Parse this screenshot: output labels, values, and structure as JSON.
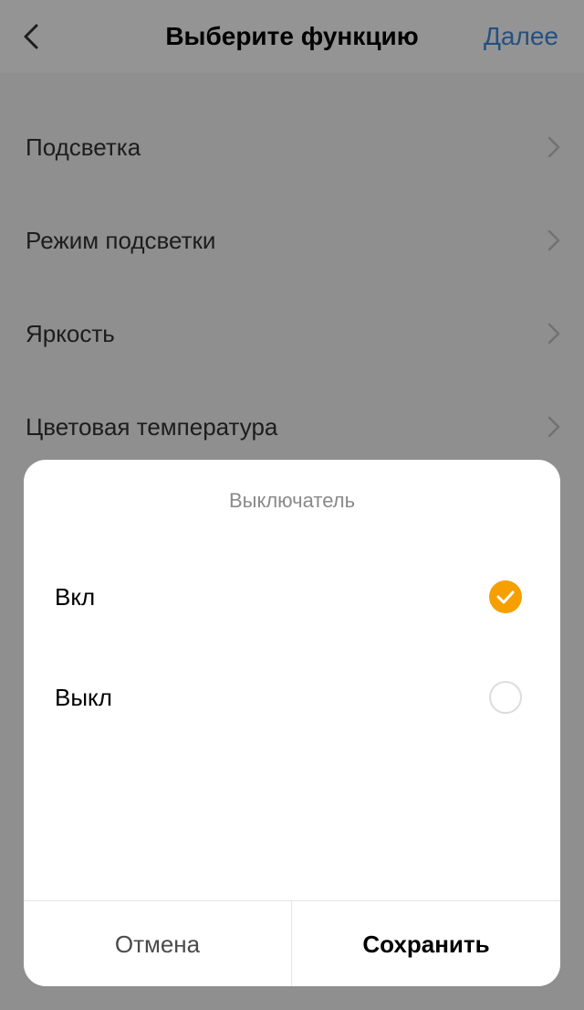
{
  "nav": {
    "title": "Выберите функцию",
    "next_label": "Далее"
  },
  "functions": [
    {
      "label": "Подсветка"
    },
    {
      "label": "Режим подсветки"
    },
    {
      "label": "Яркость"
    },
    {
      "label": "Цветовая температура"
    }
  ],
  "dialog": {
    "title": "Выключатель",
    "options": [
      {
        "label": "Вкл",
        "selected": true
      },
      {
        "label": "Выкл",
        "selected": false
      }
    ],
    "cancel_label": "Отмена",
    "save_label": "Сохранить"
  },
  "colors": {
    "accent": "#f5a000",
    "link": "#3f8bde"
  },
  "icons": {
    "back": "chevron-left-icon",
    "item_chevron": "chevron-right-icon",
    "check": "checkmark-icon"
  }
}
